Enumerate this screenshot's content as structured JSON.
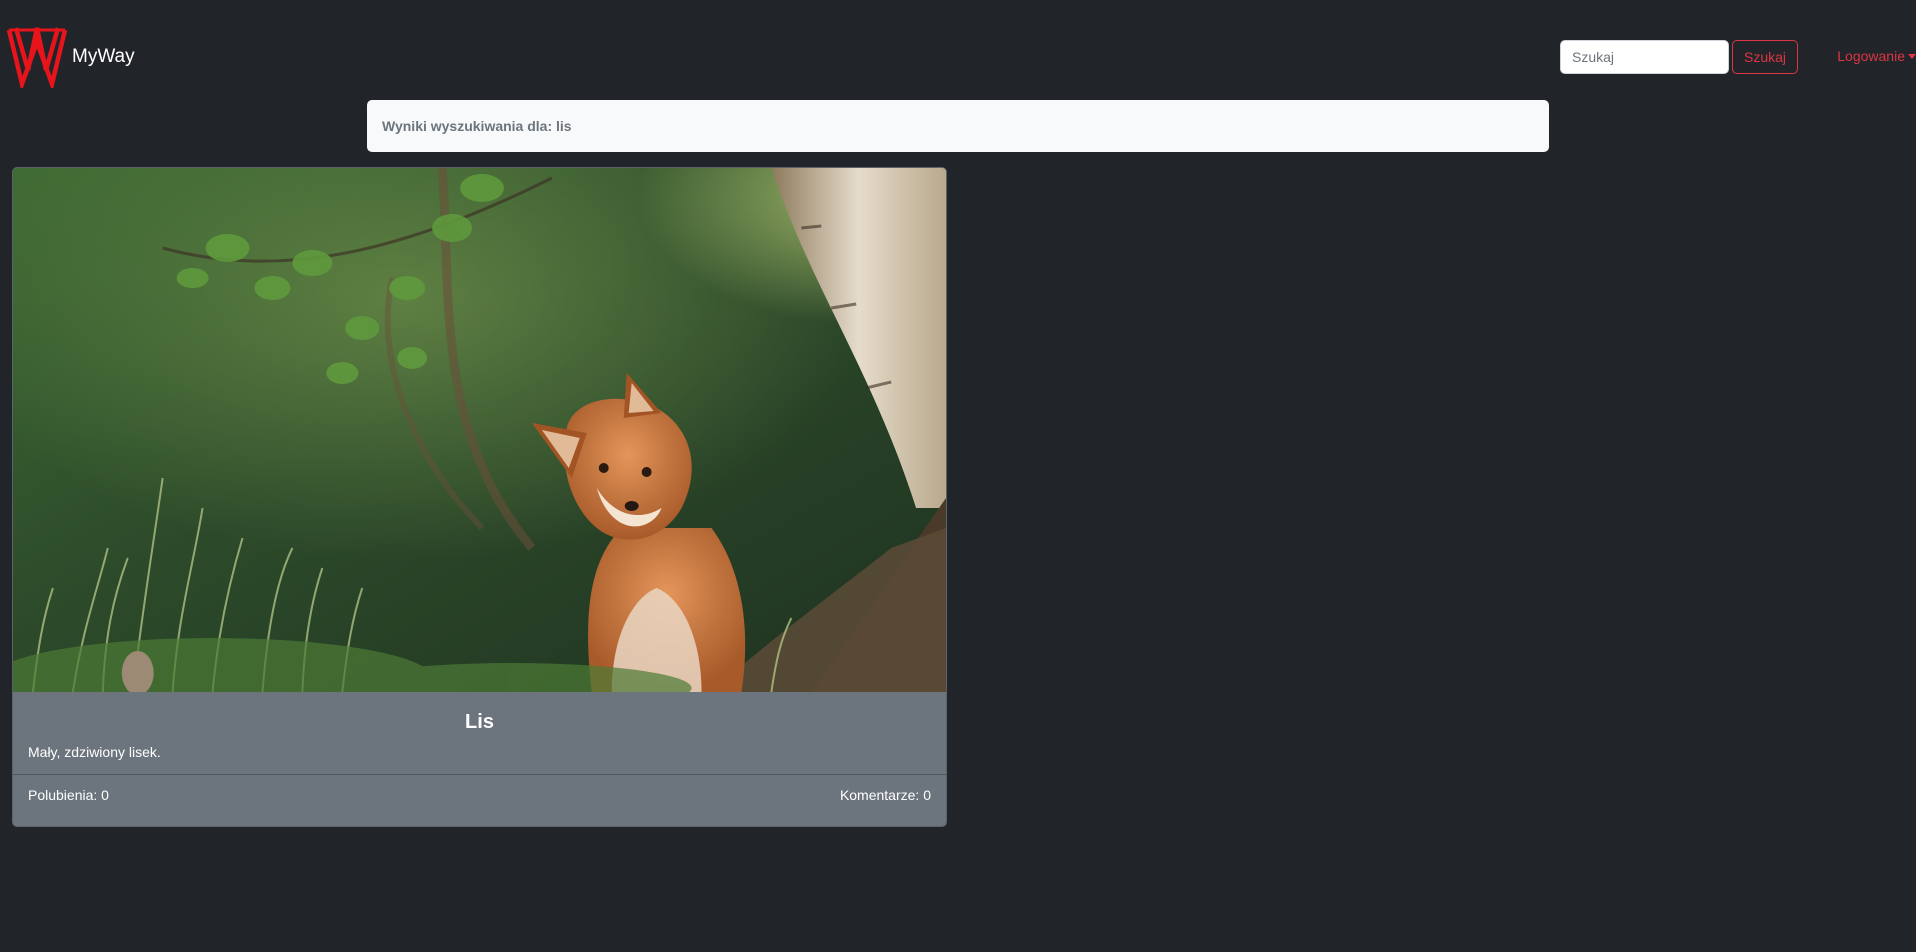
{
  "navbar": {
    "brand_name": "MyWay",
    "search": {
      "placeholder": "Szukaj",
      "value": "",
      "button_label": "Szukaj"
    },
    "login_label": "Logowanie"
  },
  "results": {
    "heading": "Wyniki wyszukiwania dla: lis"
  },
  "posts": [
    {
      "title": "Lis",
      "description": "Mały, zdziwiony lisek.",
      "likes": "Polubienia: 0",
      "comments": "Komentarze: 0"
    }
  ],
  "colors": {
    "background": "#212529",
    "accent": "#dc3545",
    "card": "#6c757d",
    "header": "#f8f9fa"
  }
}
